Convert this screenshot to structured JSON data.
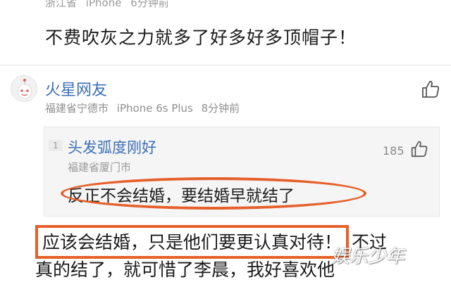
{
  "previous_comment": {
    "location": "浙江省",
    "device": "iPhone",
    "time": "6分钟前",
    "text": "不费吹灰之力就多了好多好多顶帽子！"
  },
  "comment": {
    "username": "火星网友",
    "location": "福建省宁德市",
    "device": "iPhone 6s Plus",
    "time": "8分钟前",
    "avatar_icon": "robot-avatar-icon",
    "like_icon": "thumbs-up-icon",
    "quote": {
      "index": "1",
      "username": "头发弧度刚好",
      "location": "福建省厦门市",
      "like_count": "185",
      "text": "反正不会结婚，要结婚早就结了"
    },
    "reply_highlight": "应该会结婚，只是他们要更认真对待！",
    "reply_rest": "不过",
    "reply_line2": "真的结了，就可惜了李晨，我好喜欢他"
  },
  "watermark": "娱乐少年",
  "colors": {
    "username": "#3b6fb6",
    "annotation": "#e5602a",
    "meta": "#8f8f8f"
  }
}
